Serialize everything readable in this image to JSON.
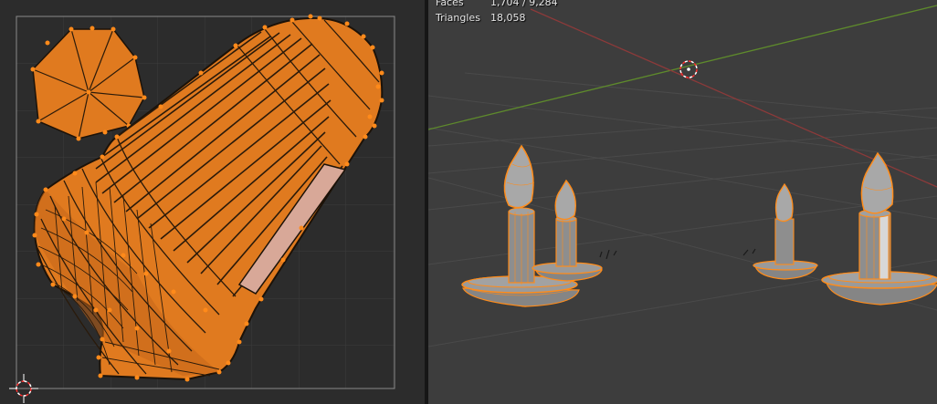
{
  "viewport": {
    "stats": [
      {
        "label": "Faces",
        "value": "1,704 / 9,284"
      },
      {
        "label": "Triangles",
        "value": "18,058"
      }
    ]
  },
  "colors": {
    "uv_fill": "#e07a1f",
    "uv_vertex": "#ff8a1a",
    "uv_edge": "#1c1208",
    "selected_face": "#d8a898",
    "viewport_bg": "#3d3d3d",
    "x_axis": "#8c3a3a",
    "y_axis": "#5e8a2c",
    "selection_outline": "#ff8c1a",
    "mesh_gray": "#8e8e8e"
  }
}
